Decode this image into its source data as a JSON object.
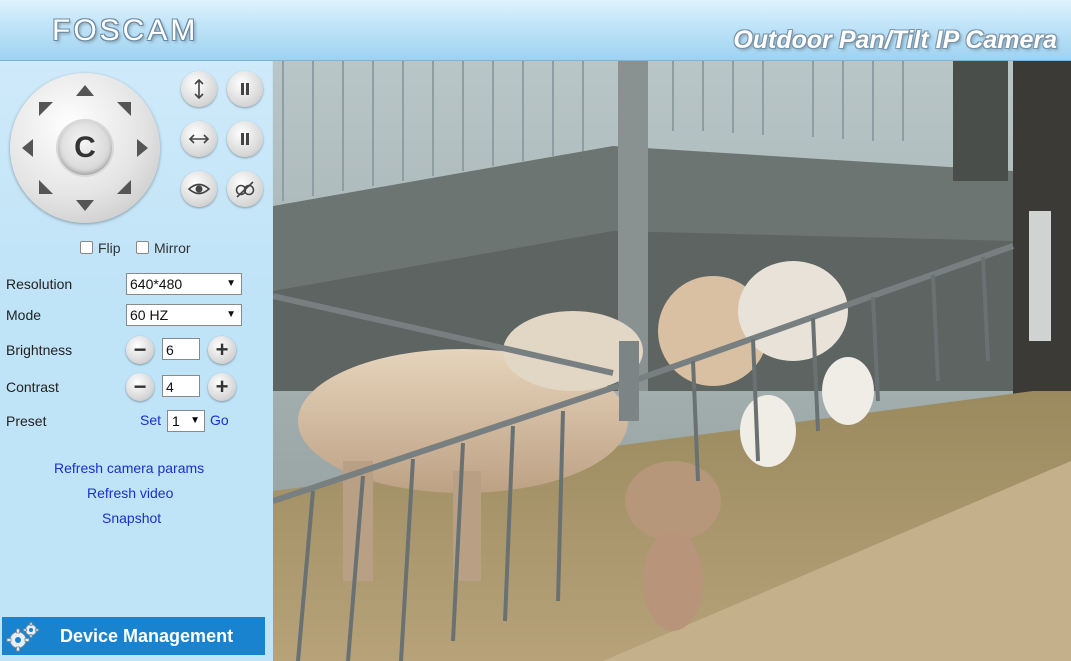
{
  "header": {
    "logo": "FOSCAM",
    "product": "Outdoor Pan/Tilt IP Camera"
  },
  "ptz": {
    "center_label": "C"
  },
  "options": {
    "flip": "Flip",
    "mirror": "Mirror"
  },
  "settings": {
    "resolution_label": "Resolution",
    "resolution_value": "640*480",
    "mode_label": "Mode",
    "mode_value": "60 HZ",
    "brightness_label": "Brightness",
    "brightness_value": "6",
    "contrast_label": "Contrast",
    "contrast_value": "4",
    "preset_label": "Preset",
    "preset_set": "Set",
    "preset_value": "1",
    "preset_go": "Go"
  },
  "links": {
    "refresh_params": "Refresh camera params",
    "refresh_video": "Refresh video",
    "snapshot": "Snapshot"
  },
  "device_management": "Device Management",
  "colors": {
    "accent": "#1a83d0",
    "link": "#1a2fd0",
    "panel": "#bfe3f7"
  }
}
